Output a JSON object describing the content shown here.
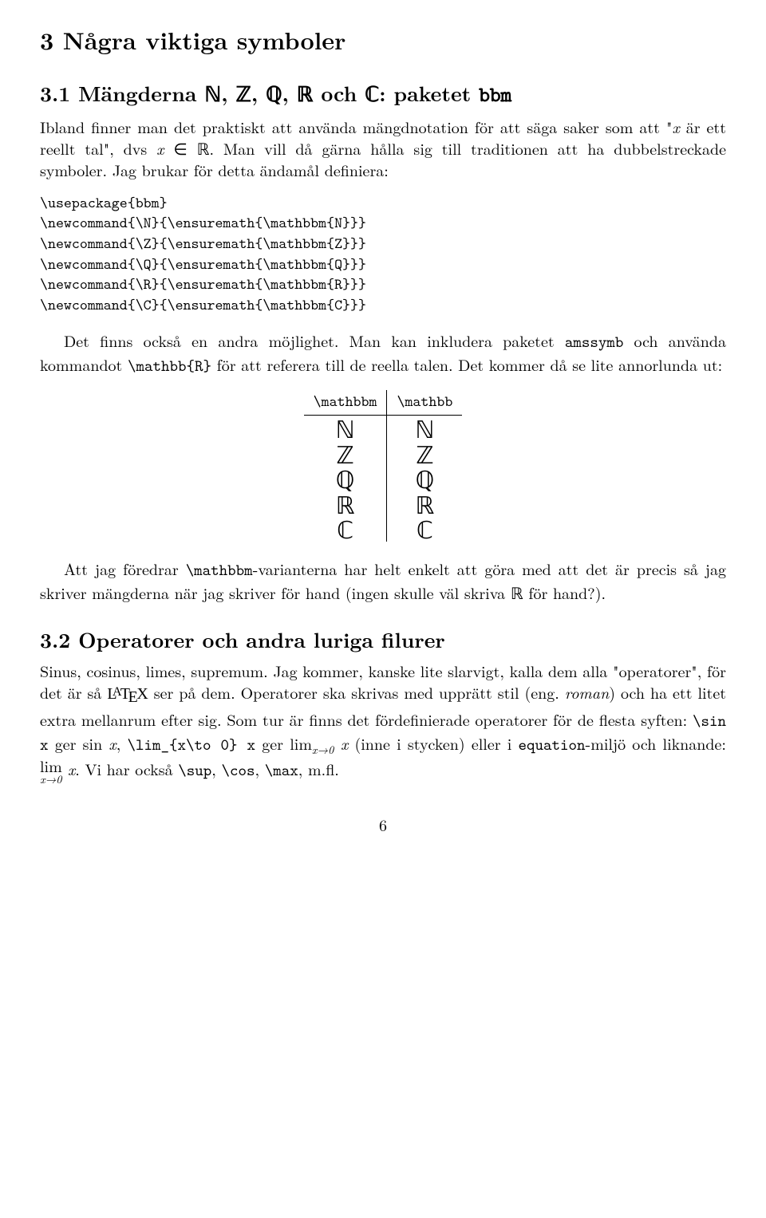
{
  "section3": {
    "heading": "3   Några viktiga symboler"
  },
  "section3_1": {
    "heading": "3.1   Mängderna ℕ, ℤ, ℚ, ℝ och ℂ: paketet ",
    "heading_tt": "bbm",
    "para1_a": "Ibland finner man det praktiskt att använda mängdnotation för att säga saker som att \"",
    "para1_b": "x",
    "para1_c": " är ett reellt tal\", dvs ",
    "para1_d": "x",
    "para1_e": " ∈ ℝ. Man vill då gärna hålla sig till traditionen att ha dubbelstreckade symboler. Jag brukar för detta ändamål definiera:",
    "code": "\\usepackage{bbm}\n\\newcommand{\\N}{\\ensuremath{\\mathbbm{N}}}\n\\newcommand{\\Z}{\\ensuremath{\\mathbbm{Z}}}\n\\newcommand{\\Q}{\\ensuremath{\\mathbbm{Q}}}\n\\newcommand{\\R}{\\ensuremath{\\mathbbm{R}}}\n\\newcommand{\\C}{\\ensuremath{\\mathbbm{C}}}",
    "para2_a": "Det finns också en andra möjlighet. Man kan inkludera paketet ",
    "para2_b": "amssymb",
    "para2_c": " och använda kommandot ",
    "para2_d": "\\mathbb{R}",
    "para2_e": " för att referera till de reella talen. Det kommer då se lite annorlunda ut:",
    "table": {
      "head_left": "\\mathbbm",
      "head_right": "\\mathbb",
      "rows": [
        {
          "l": "ℕ",
          "r": "ℕ"
        },
        {
          "l": "ℤ",
          "r": "ℤ"
        },
        {
          "l": "ℚ",
          "r": "ℚ"
        },
        {
          "l": "ℝ",
          "r": "ℝ"
        },
        {
          "l": "ℂ",
          "r": "ℂ"
        }
      ]
    },
    "para3_a": "Att jag föredrar ",
    "para3_b": "\\mathbbm",
    "para3_c": "-varianterna har helt enkelt att göra med att det är precis så jag skriver mängderna när jag skriver för hand (ingen skulle väl skriva ℝ för hand?)."
  },
  "section3_2": {
    "heading": "3.2   Operatorer och andra luriga filurer",
    "p_a": "Sinus, cosinus, limes, supremum. Jag kommer, kanske lite slarvigt, kalla dem alla \"operatorer\", för det är så ",
    "p_a2": " ser på dem. Operatorer ska skrivas med upprätt stil (eng. ",
    "p_b": "roman",
    "p_c": ") och ha ett litet extra mellanrum efter sig. Som tur är finns det fördefinierade operatorer för de flesta syften: ",
    "p_d": "\\sin x",
    "p_e": " ger sin ",
    "p_f": "x",
    "p_g": ", ",
    "p_h": "\\lim_{x\\to 0} x",
    "p_i": " ger lim",
    "p_j": "x→0",
    "p_k": " x",
    "p_l": " (inne i stycken) eller i ",
    "p_m": "equation",
    "p_n": "-miljö och liknande: ",
    "p_o": "lim",
    "p_p": "x→0",
    "p_q": " x",
    "p_r": ". Vi har också ",
    "p_s": "\\sup",
    "p_t": ", ",
    "p_u": "\\cos",
    "p_v": ", ",
    "p_w": "\\max",
    "p_x": ", m.fl."
  },
  "page": "6"
}
